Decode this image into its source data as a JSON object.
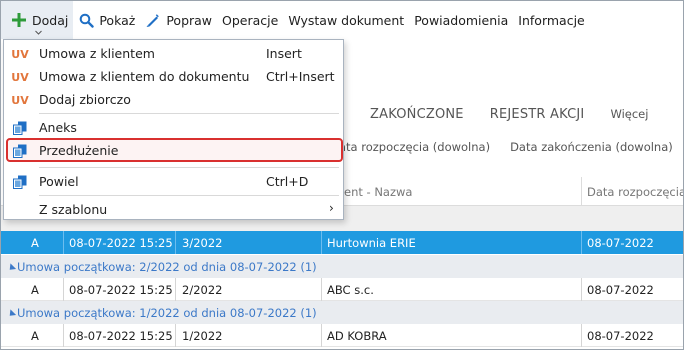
{
  "toolbar": {
    "items": [
      {
        "label": "Dodaj",
        "icon": "plus-icon"
      },
      {
        "label": "Pokaż",
        "icon": "search-icon"
      },
      {
        "label": "Popraw",
        "icon": "pencil-icon"
      },
      {
        "label": "Operacje"
      },
      {
        "label": "Wystaw dokument"
      },
      {
        "label": "Powiadomienia"
      },
      {
        "label": "Informacje"
      }
    ]
  },
  "tabs": [
    "ZAKOŃCZONE",
    "REJESTR AKCJI",
    "Więcej"
  ],
  "filters": [
    "ata rozpoczęcia (dowolna)",
    "Data zakończenia (dowolna)"
  ],
  "grid": {
    "headers": [
      "ent - Nazwa",
      "Data rozpoczęcia"
    ],
    "rows": [
      {
        "type": "selected",
        "cells": [
          "A",
          "08-07-2022 15:25",
          "3/2022",
          "Hurtownia ERIE",
          "08-07-2022"
        ]
      },
      {
        "type": "group",
        "text": "Umowa początkowa: 2/2022 od dnia 08-07-2022 (1)"
      },
      {
        "type": "data",
        "cells": [
          "A",
          "08-07-2022 15:25",
          "2/2022",
          "ABC s.c.",
          "08-07-2022"
        ]
      },
      {
        "type": "group",
        "text": "Umowa początkowa: 1/2022 od dnia 08-07-2022 (1)"
      },
      {
        "type": "data",
        "cells": [
          "A",
          "08-07-2022 15:25",
          "1/2022",
          "AD KOBRA",
          "08-07-2022"
        ]
      }
    ]
  },
  "menu": {
    "items": [
      {
        "label": "Umowa z klientem",
        "shortcut": "Insert",
        "icon": "uv-icon",
        "icon_text": "UV"
      },
      {
        "label": "Umowa z klientem do dokumentu",
        "shortcut": "Ctrl+Insert",
        "icon": "uv-icon",
        "icon_text": "UV"
      },
      {
        "label": "Dodaj zbiorczo",
        "shortcut": "",
        "icon": "uv-icon",
        "icon_text": "UV"
      },
      {
        "label": "Aneks",
        "shortcut": "",
        "icon": "document-copy-icon"
      },
      {
        "label": "Przedłużenie",
        "shortcut": "",
        "icon": "document-copy-icon"
      },
      {
        "label": "Powiel",
        "shortcut": "Ctrl+D",
        "icon": "document-copy-icon"
      },
      {
        "label": "Z szablonu",
        "shortcut": "",
        "icon": "",
        "submenu_arrow": "›"
      }
    ]
  },
  "colors": {
    "accent_blue": "#1f9ae0",
    "uv_orange": "#e2763c",
    "group_text": "#3c79c8",
    "highlight_border": "#d9302f",
    "plus_green": "#2e9b3a"
  }
}
